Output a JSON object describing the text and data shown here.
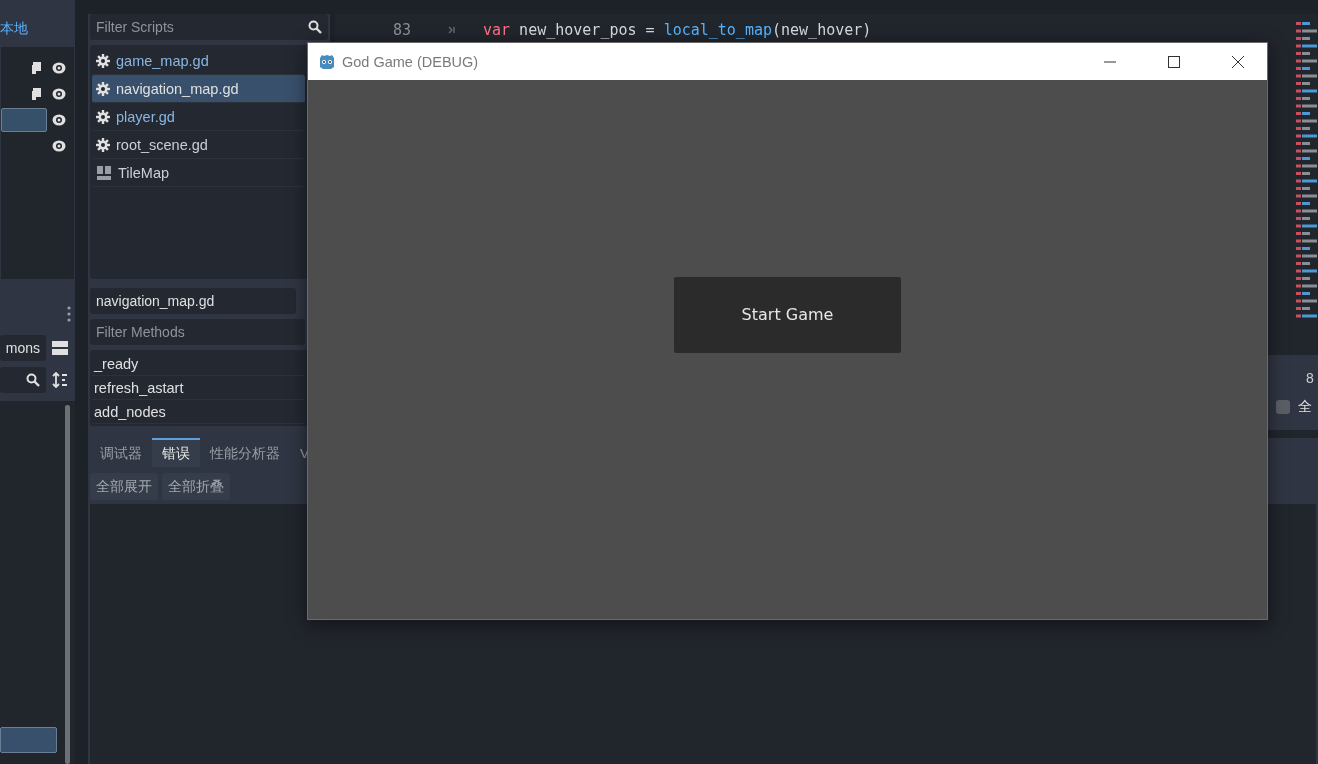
{
  "scene_dock": {
    "link": "本地",
    "rows": [
      {
        "script": true,
        "selected": false
      },
      {
        "script": true,
        "selected": false
      },
      {
        "script": false,
        "selected": true
      },
      {
        "script": false,
        "selected": false
      }
    ]
  },
  "filesystem": {
    "path_field": "mons",
    "items": [
      {
        "selected": true
      }
    ]
  },
  "script_panel": {
    "filter_placeholder": "Filter Scripts",
    "scripts": [
      {
        "name": "game_map.gd",
        "kind": "script",
        "selected": false,
        "color": "#8ab6e4"
      },
      {
        "name": "navigation_map.gd",
        "kind": "script",
        "selected": true,
        "color": "#e0e0e0"
      },
      {
        "name": "player.gd",
        "kind": "script",
        "selected": false,
        "color": "#8ab6e4"
      },
      {
        "name": "root_scene.gd",
        "kind": "script",
        "selected": false,
        "color": "#cdcfd2"
      },
      {
        "name": "TileMap",
        "kind": "doc",
        "selected": false,
        "color": "#cdcfd2"
      }
    ],
    "current_script": "navigation_map.gd",
    "methods_placeholder": "Filter Methods",
    "methods": [
      "_ready",
      "refresh_astart",
      "add_nodes"
    ]
  },
  "code_editor": {
    "lines": [
      {
        "number": "83",
        "tokens": [
          {
            "text": "var",
            "kind": "keyword"
          },
          {
            "text": " new_hover_pos = ",
            "kind": "plain"
          },
          {
            "text": "local_to_map",
            "kind": "function"
          },
          {
            "text": "(new_hover)",
            "kind": "plain"
          }
        ]
      }
    ],
    "find_bar": {
      "count": "8",
      "option": {
        "label": "全",
        "checked": false
      }
    }
  },
  "bottom_panel": {
    "tabs": [
      {
        "label": "调试器",
        "selected": false
      },
      {
        "label": "错误",
        "selected": true
      },
      {
        "label": "性能分析器",
        "selected": false
      },
      {
        "label": "V",
        "selected": false
      }
    ],
    "buttons": [
      "全部展开",
      "全部折叠"
    ]
  },
  "game_window": {
    "title": "God Game (DEBUG)",
    "button": "Start Game"
  }
}
